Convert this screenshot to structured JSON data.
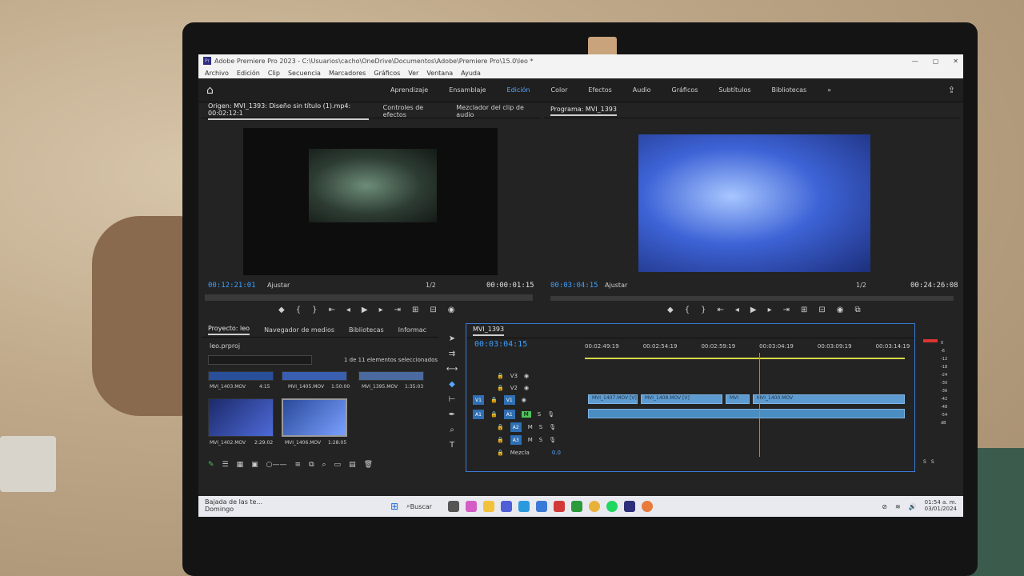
{
  "app": {
    "title": "Adobe Premiere Pro 2023 - C:\\Usuarios\\cacho\\OneDrive\\Documentos\\Adobe\\Premiere Pro\\15.0\\leo *",
    "logo": "Pr"
  },
  "menu": [
    "Archivo",
    "Edición",
    "Clip",
    "Secuencia",
    "Marcadores",
    "Gráficos",
    "Ver",
    "Ventana",
    "Ayuda"
  ],
  "workspaces": {
    "items": [
      "Aprendizaje",
      "Ensamblaje",
      "Edición",
      "Color",
      "Efectos",
      "Audio",
      "Gráficos",
      "Subtítulos",
      "Bibliotecas"
    ],
    "active": "Edición",
    "more": "»"
  },
  "source": {
    "tabs": [
      "Origen: MVI_1393: Diseño sin título (1).mp4: 00:02:12:1",
      "Controles de efectos",
      "Mezclador del clip de audio"
    ],
    "timecode": "00:12:21:01",
    "fit": "Ajustar",
    "resolution": "1/2",
    "duration": "00:00:01:15"
  },
  "program": {
    "tab": "Programa: MVI_1393",
    "timecode": "00:03:04:15",
    "fit": "Ajustar",
    "resolution": "1/2",
    "duration": "00:24:26:08"
  },
  "project": {
    "tabs": [
      "Proyecto: leo",
      "Navegador de medios",
      "Bibliotecas",
      "Informac"
    ],
    "file": "leo.prproj",
    "search_placeholder": "",
    "selection_info": "1 de 11 elementos seleccionados",
    "clips": [
      {
        "name": "MVI_1403.MOV",
        "duration": "4:15"
      },
      {
        "name": "MVI_1405.MOV",
        "duration": "1:50:00"
      },
      {
        "name": "MVI_1395.MOV",
        "duration": "1:35:03"
      },
      {
        "name": "MVI_1402.MOV",
        "duration": "2:29:02"
      },
      {
        "name": "MVI_1406.MOV",
        "duration": "1:28:05"
      }
    ]
  },
  "timeline": {
    "tab": "MVI_1393",
    "timecode": "00:03:04:15",
    "ruler": [
      "00:02:49:19",
      "00:02:54:19",
      "00:02:59:19",
      "00:03:04:19",
      "00:03:09:19",
      "00:03:14:19",
      "0"
    ],
    "tracks": [
      "V3",
      "V2",
      "V1",
      "A1",
      "A2",
      "A3"
    ],
    "mix_label": "Mezcla",
    "mix_value": "0.0",
    "clips": [
      "MVI_1407.MOV [V]",
      "MVI_1408.MOV [V]",
      "MVI",
      "MVI_1400.MOV"
    ]
  },
  "meter": {
    "scale": [
      "0",
      "-6",
      "-12",
      "-18",
      "-24",
      "-30",
      "-36",
      "-42",
      "-48",
      "-54",
      "dB"
    ],
    "solo": [
      "S",
      "S"
    ]
  },
  "taskbar": {
    "notification": "Bajada de las te...",
    "notification_sub": "Domingo",
    "search": "Buscar",
    "time": "01:54 a. m.",
    "date": "03/01/2024"
  }
}
